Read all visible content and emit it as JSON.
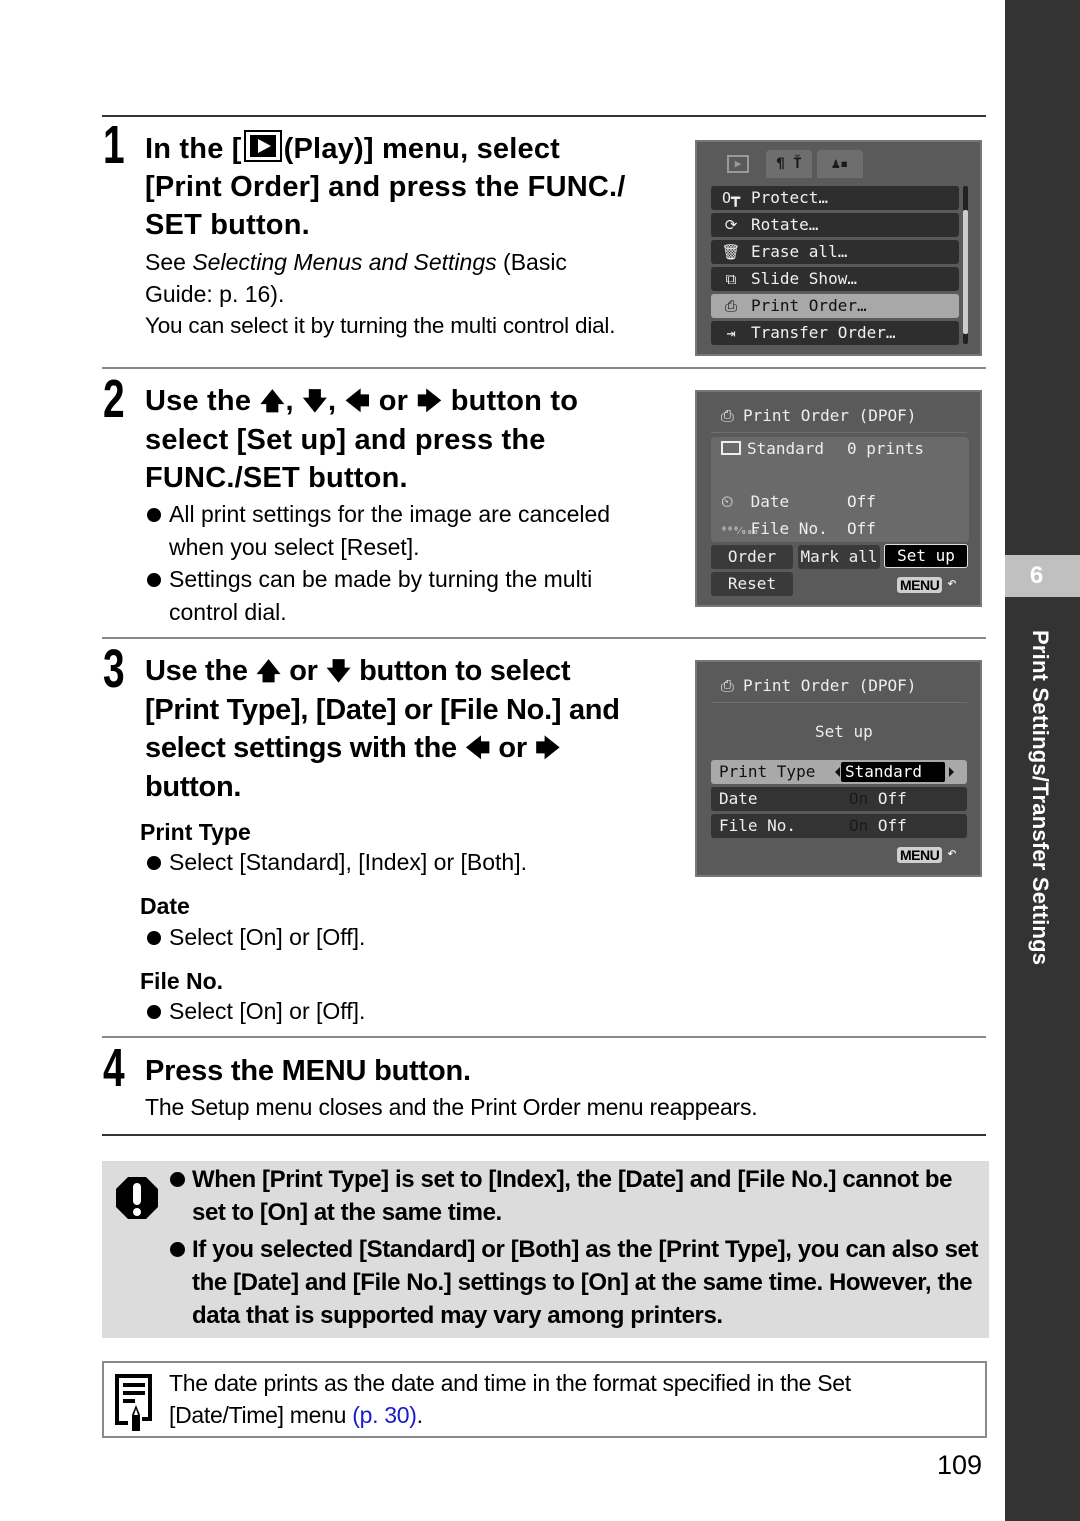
{
  "page_number": "109",
  "side_tab": {
    "chapter_number": "6",
    "chapter_title": "Print Settings/Transfer Settings"
  },
  "steps": [
    {
      "number": "1",
      "title_parts": [
        "In the [",
        "(Play)] menu, select",
        "[Print Order] and press the FUNC./",
        "SET button."
      ],
      "see_prefix": "See ",
      "see_italic": "Selecting Menus and Settings",
      "see_suffix": " (Basic",
      "see_line2": "Guide: p. 16).",
      "extra": "You can select it by turning the multi control dial."
    },
    {
      "number": "2",
      "title_line1_a": "Use the",
      "title_line1_b": ",",
      "title_line1_c": ",",
      "title_line1_d": "or",
      "title_line1_e": "button to",
      "title_line2": "select [Set up] and press the",
      "title_line3": "FUNC./SET button.",
      "bullets": [
        "All print settings for the image are canceled when you select [Reset].",
        "Settings can be made by turning the multi control dial."
      ]
    },
    {
      "number": "3",
      "title_line1_a": "Use the",
      "title_line1_b": "or",
      "title_line1_c": "button to select",
      "title_line2": "[Print Type], [Date] or [File No.] and",
      "title_line3_a": "select settings with the",
      "title_line3_b": "or",
      "title_line4": "button.",
      "subsections": [
        {
          "heading": "Print Type",
          "bullet": "Select [Standard], [Index] or [Both]."
        },
        {
          "heading": "Date",
          "bullet": "Select [On] or [Off]."
        },
        {
          "heading": "File No.",
          "bullet": "Select [On] or [Off]."
        }
      ]
    },
    {
      "number": "4",
      "title": "Press the MENU button.",
      "body": "The Setup menu closes and the Print Order menu reappears."
    }
  ],
  "icons": {
    "up": "🡅",
    "down": "🡇",
    "left": "🡄",
    "right": "🡆"
  },
  "screen1": {
    "tabs": [
      "▶",
      "ǐǐ",
      "♟"
    ],
    "items": [
      {
        "icon": "key-icon",
        "glyph": "O┳",
        "label": "Protect…"
      },
      {
        "icon": "rotate-icon",
        "glyph": "⟳",
        "label": "Rotate…"
      },
      {
        "icon": "erase-icon",
        "glyph": "🗑",
        "label": "Erase all…"
      },
      {
        "icon": "slideshow-icon",
        "glyph": "⧉",
        "label": "Slide Show…"
      },
      {
        "icon": "print-icon",
        "glyph": "⎙",
        "label": "Print Order…",
        "selected": true
      },
      {
        "icon": "transfer-icon",
        "glyph": "⇥",
        "label": "Transfer Order…"
      }
    ]
  },
  "screen2": {
    "title": "Print Order (DPOF)",
    "type_label": "Standard",
    "type_value": "0 prints",
    "date_label": "Date",
    "date_value": "Off",
    "fileno_label": "File No.",
    "fileno_value": "Off",
    "buttons": {
      "order": "Order",
      "mark_all": "Mark all",
      "set_up": "Set up",
      "reset": "Reset"
    },
    "menu_label": "MENU",
    "selected_button": "Set up"
  },
  "screen3": {
    "title": "Print Order (DPOF)",
    "subtitle": "Set up",
    "rows": [
      {
        "label": "Print Type",
        "value": "Standard",
        "selected": true
      },
      {
        "label": "Date",
        "on": "On",
        "off": "Off",
        "current": "Off"
      },
      {
        "label": "File No.",
        "on": "On",
        "off": "Off",
        "current": "Off"
      }
    ],
    "menu_label": "MENU"
  },
  "caution": {
    "bullets": [
      "When [Print Type] is set to [Index], the [Date] and [File No.] cannot be set to [On] at the same time.",
      "If you selected [Standard] or [Both] as the [Print Type], you can also set the [Date] and [File No.] settings to [On] at the same time. However, the data that is supported may vary among printers."
    ]
  },
  "note": {
    "text": "The date prints as the date and time in the format specified in the Set [Date/Time] menu ",
    "link": "(p. 30)",
    "suffix": "."
  },
  "colors": {
    "sidebar": "#333333",
    "side_tab": "#c0c0c0",
    "caution_bg": "#dcdcdc",
    "link": "#1a1acc",
    "screen_bg": "#5a5a5a"
  }
}
